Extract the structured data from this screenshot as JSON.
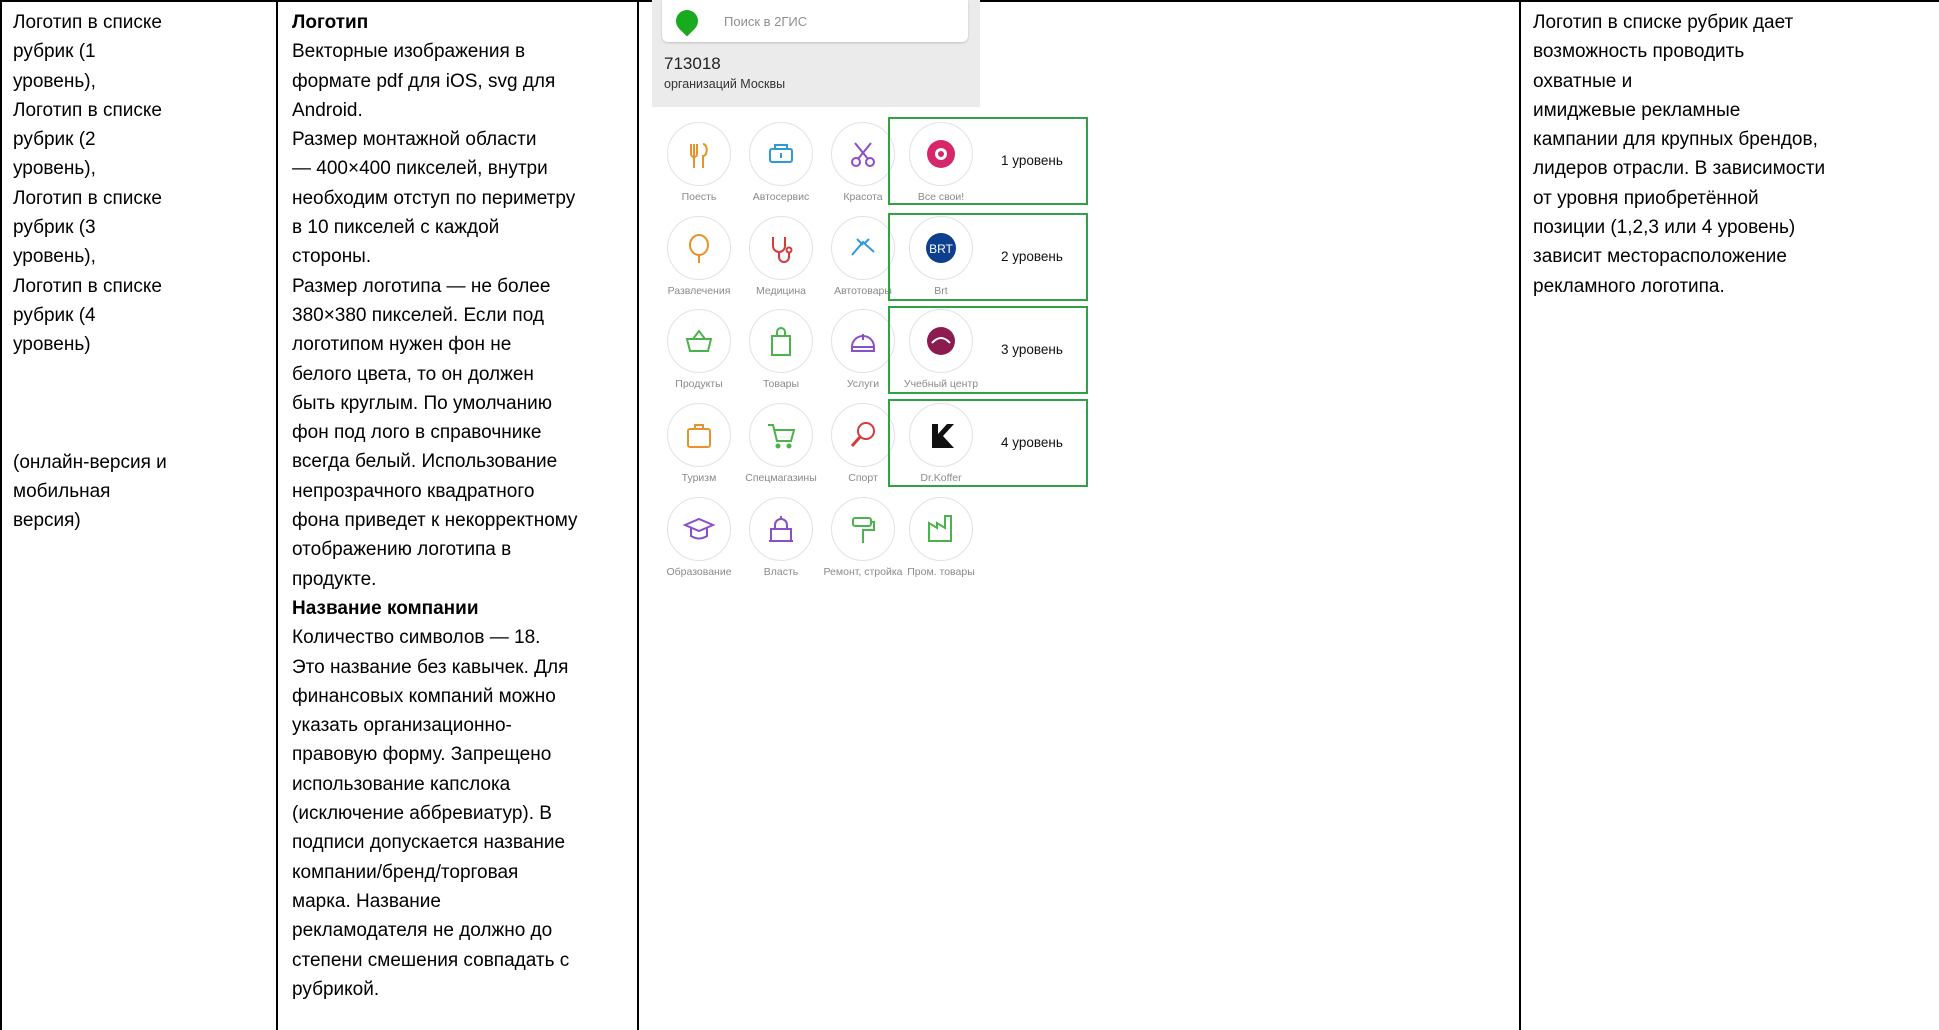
{
  "col1": {
    "lines": [
      "Логотип в списке",
      "рубрик (1",
      "уровень),",
      "Логотип в списке",
      "рубрик (2",
      "уровень),",
      "Логотип в списке",
      "рубрик (3",
      "уровень),",
      "Логотип в списке",
      "рубрик (4",
      "уровень)"
    ],
    "note_lines": [
      "(онлайн-версия и",
      "мобильная",
      "версия)"
    ]
  },
  "col2": {
    "logo_heading": "Логотип",
    "logo_lines": [
      "Векторные изображения в",
      "формате pdf для iOS, svg для",
      "Android.",
      "Размер монтажной области",
      "— 400×400 пикселей, внутри",
      "необходим отступ по периметру",
      "в 10 пикселей с каждой",
      "стороны.",
      "Размер логотипа — не более",
      "380×380 пикселей. Если под",
      "логотипом нужен фон не",
      "белого цвета, то он должен",
      "быть круглым. По умолчанию",
      "фон под лого в справочнике",
      "всегда белый. Использование",
      "непрозрачного квадратного",
      "фона приведет к некорректному",
      "отображению логотипа в",
      "продукте."
    ],
    "name_heading": "Название компании",
    "name_lines": [
      "Количество символов — 18.",
      "Это название без кавычек. Для",
      "финансовых компаний можно",
      "указать организационно-",
      "правовую форму. Запрещено",
      "использование капслока",
      "(исключение аббревиатур). В",
      "подписи допускается название",
      "компании/бренд/торговая",
      "марка. Название",
      "рекламодателя не должно до",
      "степени смешения совпадать с",
      "рубрикой."
    ]
  },
  "col4": {
    "lines": [
      "Логотип в списке рубрик дает",
      "возможность проводить",
      "охватные и",
      "имиджевые рекламные",
      "кампании для крупных брендов,",
      "лидеров отрасли. В зависимости",
      "от уровня приобретённой",
      "позиции (1,2,3 или 4 уровень)",
      "зависит месторасположение",
      "рекламного логотипа."
    ]
  },
  "mockup": {
    "search_placeholder": "Поиск в 2ГИС",
    "org_count": "713018",
    "org_subtitle": "организаций Москвы",
    "accent_color": "#32a044",
    "tiles": [
      {
        "label": "Поесть",
        "icon": "fork-knife-icon",
        "color": "#e8922b"
      },
      {
        "label": "Автосервис",
        "icon": "engine-icon",
        "color": "#2e9bd6"
      },
      {
        "label": "Красота",
        "icon": "scissors-icon",
        "color": "#8a4fc9"
      },
      {
        "label": "Все свои!",
        "icon": "flower-logo-icon",
        "color": "#d6276b"
      },
      {
        "label": "Развлечения",
        "icon": "balloon-icon",
        "color": "#e8922b"
      },
      {
        "label": "Медицина",
        "icon": "stethoscope-icon",
        "color": "#d63a3a"
      },
      {
        "label": "Автотовары",
        "icon": "car-parts-icon",
        "color": "#2e9bd6"
      },
      {
        "label": "Brt",
        "icon": "brt-logo-icon",
        "color": "#0e3f8c"
      },
      {
        "label": "Продукты",
        "icon": "basket-icon",
        "color": "#4bb34b"
      },
      {
        "label": "Товары",
        "icon": "shopping-bag-icon",
        "color": "#4bb34b"
      },
      {
        "label": "Услуги",
        "icon": "helmet-icon",
        "color": "#8a4fc9"
      },
      {
        "label": "Учебный центр",
        "icon": "education-center-logo-icon",
        "color": "#8c1c4f"
      },
      {
        "label": "Туризм",
        "icon": "suitcase-icon",
        "color": "#e8922b"
      },
      {
        "label": "Спецмагазины",
        "icon": "cart-icon",
        "color": "#4bb34b"
      },
      {
        "label": "Спорт",
        "icon": "ping-pong-icon",
        "color": "#d63a3a"
      },
      {
        "label": "Dr.Koffer",
        "icon": "drkoffer-logo-icon",
        "color": "#111111"
      },
      {
        "label": "Образование",
        "icon": "graduation-cap-icon",
        "color": "#8a4fc9"
      },
      {
        "label": "Власть",
        "icon": "government-building-icon",
        "color": "#8a4fc9"
      },
      {
        "label": "Ремонт, стройка",
        "icon": "paint-roller-icon",
        "color": "#4bb34b"
      },
      {
        "label": "Пром. товары",
        "icon": "factory-icon",
        "color": "#4bb34b"
      }
    ],
    "levels": [
      "1 уровень",
      "2 уровень",
      "3 уровень",
      "4 уровень"
    ]
  }
}
